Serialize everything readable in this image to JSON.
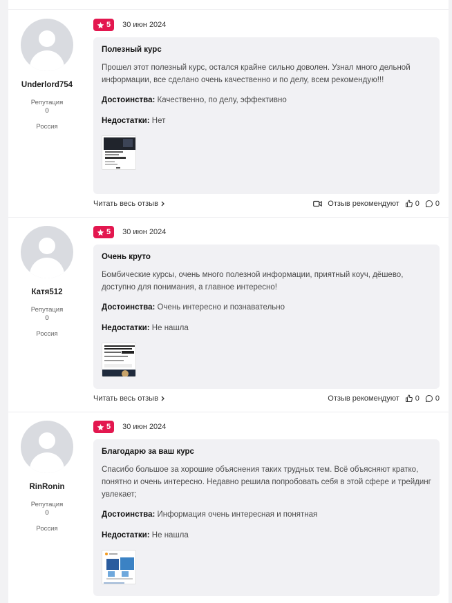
{
  "reviews": [
    {
      "author": {
        "name": "Underlord754",
        "reputation_label": "Репутация",
        "reputation_value": "0",
        "country": "Россия"
      },
      "rating": "5",
      "date": "30 июн 2024",
      "title": "Полезный курс",
      "text": "Прошел этот полезный курс, остался крайне сильно доволен. Узнал много дельной информации, все сделано очень качественно и по делу, всем рекомендую!!!",
      "pros_label": "Достоинства:",
      "pros": "Качественно, по делу, эффективно",
      "cons_label": "Недостатки:",
      "cons": "Нет",
      "read_more": "Читать весь отзыв",
      "recommend": "Отзыв рекомендуют",
      "likes": "0",
      "comments": "0",
      "has_video": true
    },
    {
      "author": {
        "name": "Катя512",
        "reputation_label": "Репутация",
        "reputation_value": "0",
        "country": "Россия"
      },
      "rating": "5",
      "date": "30 июн 2024",
      "title": "Очень круто",
      "text": "Бомбические курсы, очень много полезной информации, приятный коуч, дёшево, доступно для понимания, а главное интересно!",
      "pros_label": "Достоинства:",
      "pros": "Очень интересно и познавательно",
      "cons_label": "Недостатки:",
      "cons": "Не нашла",
      "read_more": "Читать весь отзыв",
      "recommend": "Отзыв рекомендуют",
      "likes": "0",
      "comments": "0",
      "has_video": false
    },
    {
      "author": {
        "name": "RinRonin",
        "reputation_label": "Репутация",
        "reputation_value": "0",
        "country": "Россия"
      },
      "rating": "5",
      "date": "30 июн 2024",
      "title": "Благодарю за ваш курс",
      "text": "Спасибо большое за хорошие объяснения таких трудных тем. Всё объясняют кратко, понятно и очень интересно. Недавно решила попробовать себя в этой сфере и трейдинг увлекает;",
      "pros_label": "Достоинства:",
      "pros": "Информация очень интересная и понятная",
      "cons_label": "Недостатки:",
      "cons": "Не нашла"
    }
  ],
  "colors": {
    "accent": "#e3174f",
    "card_bg": "#f1f1f4"
  },
  "icons": [
    "star-icon",
    "video-icon",
    "thumbs-up-icon",
    "comment-icon",
    "chevron-right-icon"
  ]
}
